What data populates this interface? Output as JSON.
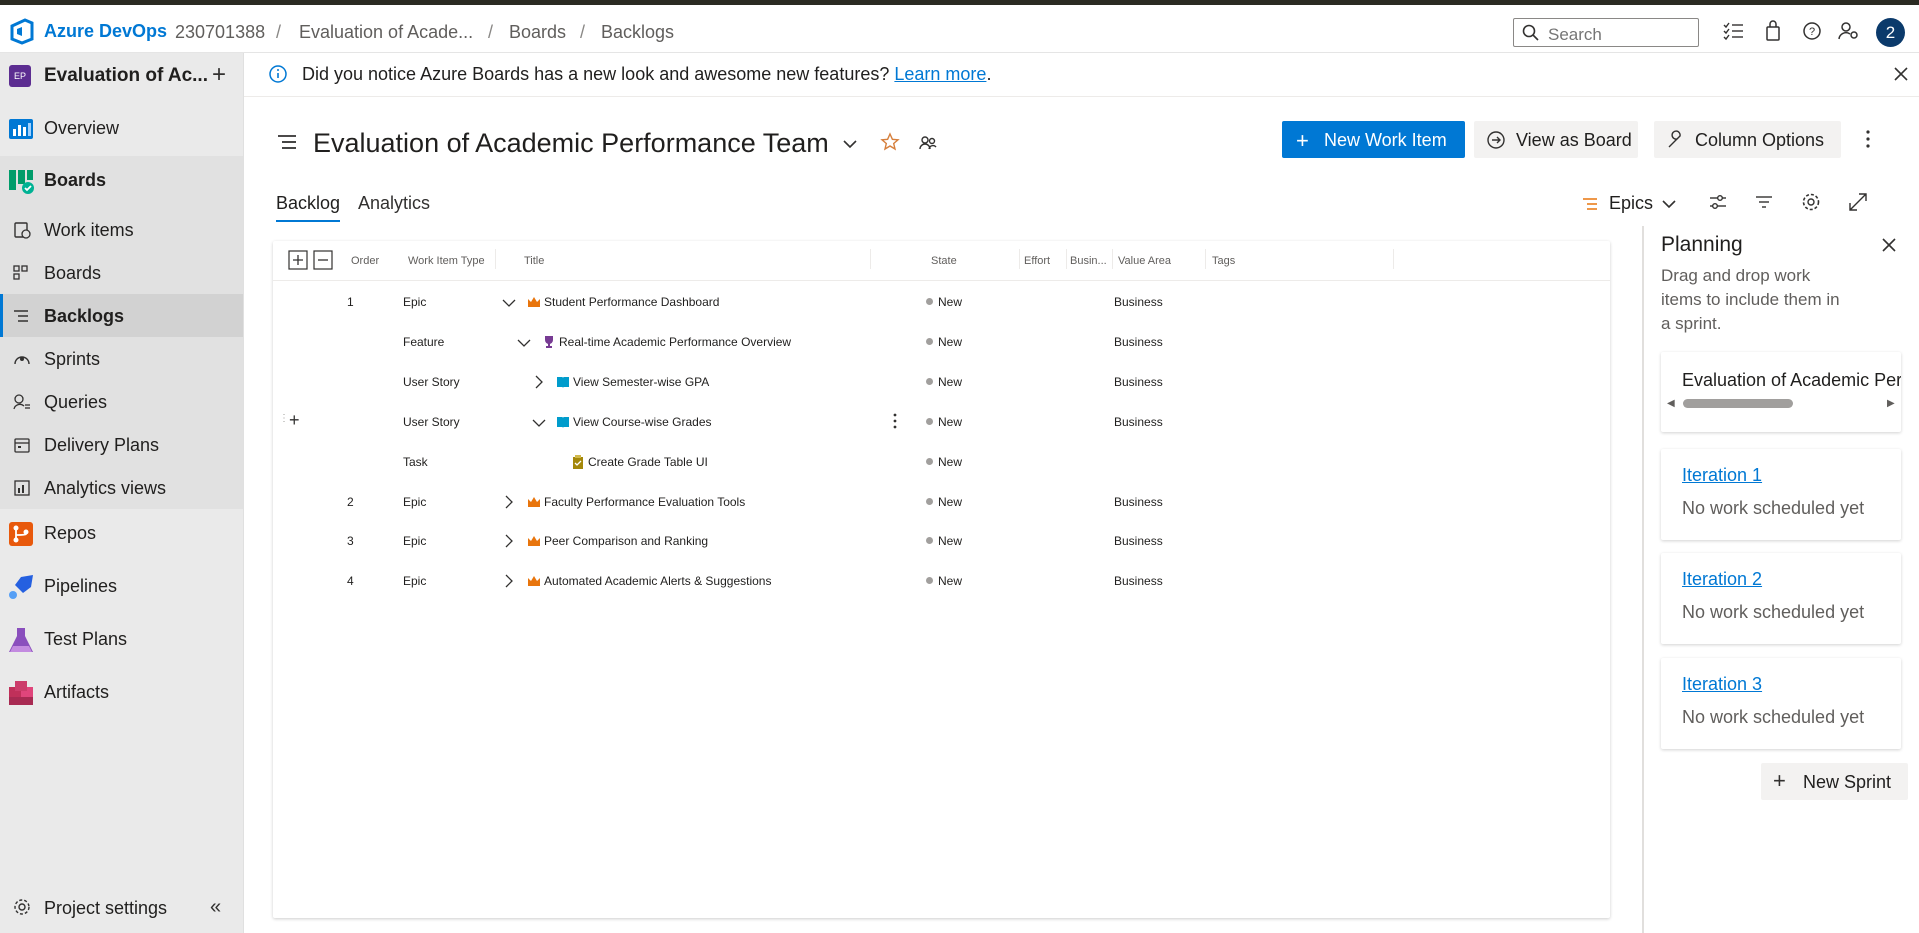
{
  "topbar": {
    "brand": "Azure DevOps",
    "breadcrumb": [
      "230701388",
      "Evaluation of Acade...",
      "Boards",
      "Backlogs"
    ],
    "search_placeholder": "Search",
    "avatar_initial": "2"
  },
  "sidebar": {
    "project_badge": "EP",
    "project_name": "Evaluation of Ac...",
    "items": [
      {
        "label": "Overview"
      },
      {
        "label": "Boards"
      },
      {
        "label": "Work items"
      },
      {
        "label": "Boards"
      },
      {
        "label": "Backlogs"
      },
      {
        "label": "Sprints"
      },
      {
        "label": "Queries"
      },
      {
        "label": "Delivery Plans"
      },
      {
        "label": "Analytics views"
      },
      {
        "label": "Repos"
      },
      {
        "label": "Pipelines"
      },
      {
        "label": "Test Plans"
      },
      {
        "label": "Artifacts"
      }
    ],
    "settings_label": "Project settings"
  },
  "banner": {
    "text": "Did you notice Azure Boards has a new look and awesome new features?",
    "link": "Learn more",
    "period": "."
  },
  "header": {
    "title": "Evaluation of Academic Performance Team",
    "new_work_item": "New Work Item",
    "view_as_board": "View as Board",
    "column_options": "Column Options"
  },
  "tabs": {
    "backlog": "Backlog",
    "analytics": "Analytics",
    "level": "Epics"
  },
  "grid": {
    "columns": [
      "Order",
      "Work Item Type",
      "Title",
      "State",
      "Effort",
      "Busin...",
      "Value Area",
      "Tags"
    ],
    "rows": [
      {
        "order": "1",
        "type": "Epic",
        "title": "Student Performance Dashboard",
        "state": "New",
        "value_area": "Business"
      },
      {
        "order": "",
        "type": "Feature",
        "title": "Real-time Academic Performance Overview",
        "state": "New",
        "value_area": "Business"
      },
      {
        "order": "",
        "type": "User Story",
        "title": "View Semester-wise GPA",
        "state": "New",
        "value_area": "Business"
      },
      {
        "order": "",
        "type": "User Story",
        "title": "View Course-wise Grades",
        "state": "New",
        "value_area": "Business"
      },
      {
        "order": "",
        "type": "Task",
        "title": "Create Grade Table UI",
        "state": "New",
        "value_area": ""
      },
      {
        "order": "2",
        "type": "Epic",
        "title": "Faculty Performance Evaluation Tools",
        "state": "New",
        "value_area": "Business"
      },
      {
        "order": "3",
        "type": "Epic",
        "title": "Peer Comparison and Ranking",
        "state": "New",
        "value_area": "Business"
      },
      {
        "order": "4",
        "type": "Epic",
        "title": "Automated Academic Alerts & Suggestions",
        "state": "New",
        "value_area": "Business"
      }
    ]
  },
  "planning": {
    "title": "Planning",
    "description": "Drag and drop work items to include them in a sprint.",
    "team_backlog": "Evaluation of Academic Perfo",
    "iterations": [
      {
        "name": "Iteration 1",
        "status": "No work scheduled yet"
      },
      {
        "name": "Iteration 2",
        "status": "No work scheduled yet"
      },
      {
        "name": "Iteration 3",
        "status": "No work scheduled yet"
      }
    ],
    "new_sprint": "New Sprint"
  },
  "colors": {
    "accent": "#0078d4",
    "epic": "#e8750d",
    "feature": "#773b93",
    "user_story": "#009ccc",
    "task": "#a4880a"
  }
}
